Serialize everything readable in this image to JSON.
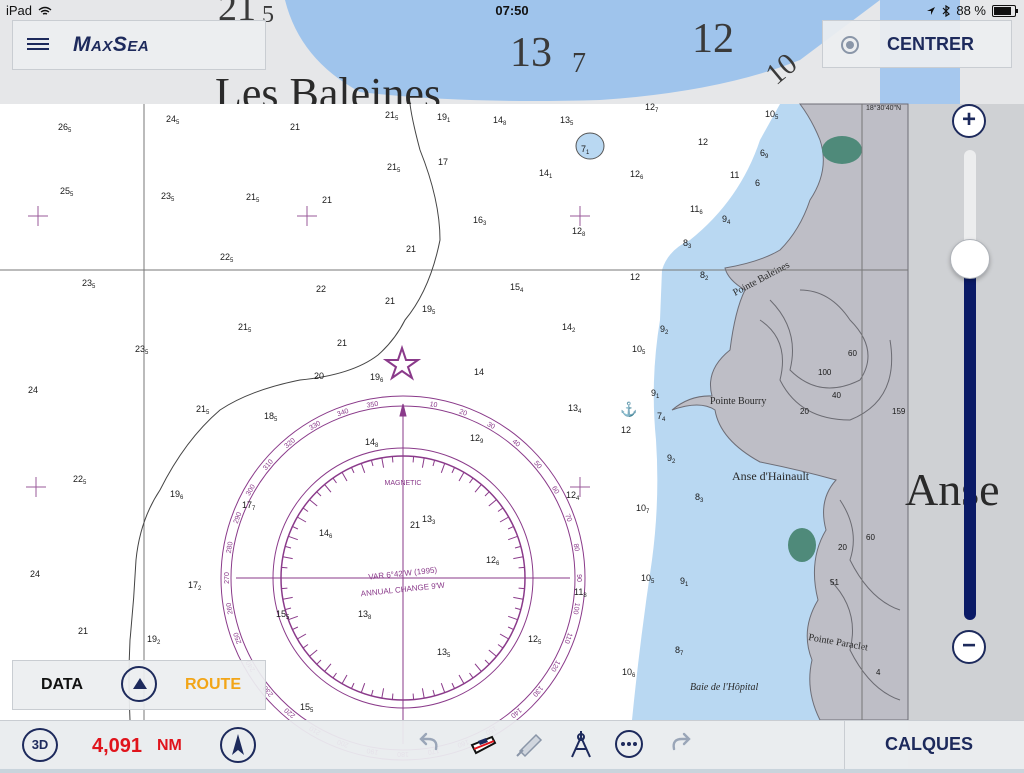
{
  "status_bar": {
    "device": "iPad",
    "time": "07:50",
    "battery": "88 %"
  },
  "brand": {
    "name": "MaxSea"
  },
  "center_button": {
    "label": "CENTRER"
  },
  "zoom": {
    "plus": "+",
    "minus": "−",
    "level_fraction": 0.77
  },
  "mode_panel": {
    "data_label": "DATA",
    "route_label": "ROUTE"
  },
  "bottom_bar": {
    "view_3d_label": "3D",
    "distance_value": "4,091",
    "distance_unit": "NM",
    "layers_label": "CALQUES"
  },
  "colors": {
    "brand_navy": "#1d2a5c",
    "route_orange": "#f2a518",
    "distance_red": "#e0141c",
    "sea_blue": "#b9d8f2",
    "land_gray": "#bebec6",
    "compass_purple": "#8a3a8a"
  },
  "icons": [
    "menu-icon",
    "target-icon",
    "undo-icon",
    "boat-icon",
    "satellite-icon",
    "compass-dividers-icon",
    "more-icon",
    "redo-icon",
    "north-up-icon",
    "wifi-icon",
    "location-icon",
    "bluetooth-icon",
    "battery-icon"
  ],
  "chart_labels": {
    "top_coast": "Les Baleines",
    "right_coast": "Anse",
    "pointe_baleines": "Pointe Baleines",
    "pointe_bourry": "Pointe Bourry",
    "anse_hainault": "Anse d'Hainault",
    "pointe_paraclet": "Pointe Paraclet",
    "baie_hopital": "Baie de l'Hôpital",
    "corner_coord": "18°30'40\"N",
    "compass_magnetic": "MAGNETIC",
    "compass_var": "VAR 6°42'W (1995)",
    "compass_change": "ANNUAL CHANGE 9'W",
    "top_depths": [
      {
        "d": "21",
        "s": "5"
      },
      {
        "d": "13",
        "s": "7"
      },
      {
        "d": "12",
        "s": ""
      },
      {
        "d": "10",
        "s": ""
      }
    ],
    "depths": [
      {
        "d": "26",
        "s": "5"
      },
      {
        "d": "24",
        "s": "5"
      },
      {
        "d": "21",
        "s": ""
      },
      {
        "d": "21",
        "s": "5"
      },
      {
        "d": "19",
        "s": "1"
      },
      {
        "d": "14",
        "s": "8"
      },
      {
        "d": "13",
        "s": "5"
      },
      {
        "d": "12",
        "s": "7"
      },
      {
        "d": "10",
        "s": "5"
      },
      {
        "d": "17",
        "s": ""
      },
      {
        "d": "21",
        "s": "5"
      },
      {
        "d": "14",
        "s": "1"
      },
      {
        "d": "12",
        "s": "6"
      },
      {
        "d": "12",
        "s": ""
      },
      {
        "d": "7",
        "s": "1"
      },
      {
        "d": "6",
        "s": "9"
      },
      {
        "d": "25",
        "s": "5"
      },
      {
        "d": "23",
        "s": "5"
      },
      {
        "d": "21",
        "s": "5"
      },
      {
        "d": "21",
        "s": ""
      },
      {
        "d": "16",
        "s": "3"
      },
      {
        "d": "12",
        "s": "8"
      },
      {
        "d": "11",
        "s": "6"
      },
      {
        "d": "11",
        "s": ""
      },
      {
        "d": "6",
        "s": ""
      },
      {
        "d": "9",
        "s": "4"
      },
      {
        "d": "22",
        "s": "5"
      },
      {
        "d": "21",
        "s": ""
      },
      {
        "d": "8",
        "s": "3"
      },
      {
        "d": "12",
        "s": ""
      },
      {
        "d": "8",
        "s": "2"
      },
      {
        "d": "23",
        "s": "5"
      },
      {
        "d": "22",
        "s": ""
      },
      {
        "d": "15",
        "s": "4"
      },
      {
        "d": "21",
        "s": ""
      },
      {
        "d": "19",
        "s": "5"
      },
      {
        "d": "21",
        "s": "5"
      },
      {
        "d": "14",
        "s": "2"
      },
      {
        "d": "9",
        "s": "2"
      },
      {
        "d": "23",
        "s": "5"
      },
      {
        "d": "21",
        "s": ""
      },
      {
        "d": "10",
        "s": "5"
      },
      {
        "d": "24",
        "s": ""
      },
      {
        "d": "20",
        "s": ""
      },
      {
        "d": "19",
        "s": "6"
      },
      {
        "d": "14",
        "s": ""
      },
      {
        "d": "9",
        "s": "1"
      },
      {
        "d": "21",
        "s": "5"
      },
      {
        "d": "18",
        "s": "5"
      },
      {
        "d": "13",
        "s": "4"
      },
      {
        "d": "7",
        "s": "4"
      },
      {
        "d": "12",
        "s": ""
      },
      {
        "d": "14",
        "s": "8"
      },
      {
        "d": "12",
        "s": "9"
      },
      {
        "d": "9",
        "s": "2"
      },
      {
        "d": "22",
        "s": "5"
      },
      {
        "d": "19",
        "s": "6"
      },
      {
        "d": "12",
        "s": "4"
      },
      {
        "d": "8",
        "s": "3"
      },
      {
        "d": "17",
        "s": "7"
      },
      {
        "d": "13",
        "s": "3"
      },
      {
        "d": "10",
        "s": "7"
      },
      {
        "d": "14",
        "s": "6"
      },
      {
        "d": "21",
        "s": ""
      },
      {
        "d": "12",
        "s": "6"
      },
      {
        "d": "24",
        "s": ""
      },
      {
        "d": "17",
        "s": "2"
      },
      {
        "d": "11",
        "s": "8"
      },
      {
        "d": "10",
        "s": "5"
      },
      {
        "d": "9",
        "s": "1"
      },
      {
        "d": "15",
        "s": "5"
      },
      {
        "d": "13",
        "s": "8"
      },
      {
        "d": "21",
        "s": ""
      },
      {
        "d": "19",
        "s": "2"
      },
      {
        "d": "12",
        "s": "5"
      },
      {
        "d": "8",
        "s": "7"
      },
      {
        "d": "13",
        "s": "5"
      },
      {
        "d": "10",
        "s": "6"
      },
      {
        "d": "15",
        "s": "5"
      }
    ],
    "land_contours": [
      "60",
      "100",
      "40",
      "20",
      "60",
      "20",
      "51",
      "4",
      "159"
    ],
    "compass_ticks": [
      "350",
      "10",
      "20",
      "30",
      "40",
      "50",
      "60",
      "70",
      "80",
      "90",
      "100",
      "110",
      "120",
      "130",
      "140",
      "150",
      "160",
      "170",
      "180",
      "190",
      "200",
      "210",
      "220",
      "230",
      "240",
      "250",
      "260",
      "270",
      "280",
      "290",
      "300",
      "310",
      "320",
      "330",
      "340"
    ]
  }
}
